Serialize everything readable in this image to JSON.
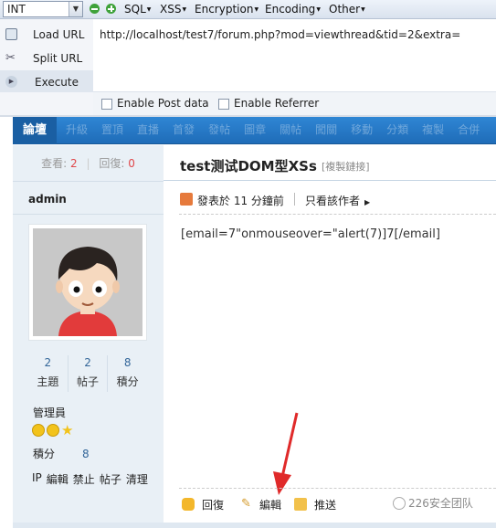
{
  "hackbar": {
    "int_select": "INT",
    "menus": [
      "SQL",
      "XSS",
      "Encryption",
      "Encoding",
      "Other"
    ],
    "buttons": {
      "load": "Load URL",
      "split": "Split URL",
      "execute": "Execute"
    },
    "url": "http://localhost/test7/forum.php?mod=viewthread&tid=2&extra=",
    "options": {
      "post": "Enable Post data",
      "referrer": "Enable Referrer"
    }
  },
  "nav": {
    "home": "論壇",
    "items": [
      "升級",
      "置頂",
      "直播",
      "首發",
      "發帖",
      "圖章",
      "關帖",
      "闖關",
      "移動",
      "分類",
      "複製",
      "合併"
    ]
  },
  "thread_stats": {
    "views_label": "查看:",
    "views": "2",
    "replies_label": "回復:",
    "replies": "0"
  },
  "user": {
    "name": "admin",
    "counts": [
      {
        "value": "2",
        "label": "主題"
      },
      {
        "value": "2",
        "label": "帖子"
      },
      {
        "value": "8",
        "label": "積分"
      }
    ],
    "rank": "管理員",
    "points_label": "積分",
    "points": "8",
    "admin_links": [
      "IP",
      "編輯",
      "禁止",
      "帖子",
      "清理"
    ]
  },
  "post": {
    "title": "test测试DOM型XSs",
    "copy_link": "[複製鏈接]",
    "posted": "發表於 11 分鐘前",
    "only_author": "只看該作者",
    "content": "[email=7\"onmouseover=\"alert(7)]7[/email]",
    "actions": {
      "reply": "回復",
      "edit": "編輯",
      "push": "推送"
    }
  },
  "watermark": "226安全团队",
  "colors": {
    "nav": "#2277c6",
    "accent": "#e0474a",
    "link": "#336699"
  }
}
